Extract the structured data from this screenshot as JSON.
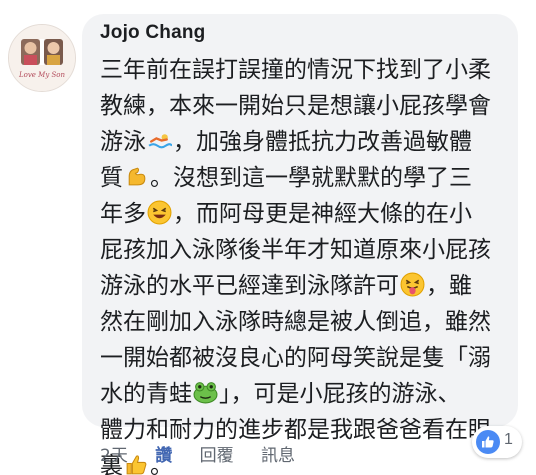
{
  "comment": {
    "author": "Jojo Chang",
    "avatar_caption": "Love My Son",
    "lines": [
      [
        "三年前在誤打誤撞的情況下找到了小柔"
      ],
      [
        "教練，本來一開始只是想讓小屁孩學會"
      ],
      [
        "游泳",
        "",
        "，加強身體抵抗力改善過敏體"
      ],
      [
        "質",
        "",
        "。沒想到這一學就默默的學了三"
      ],
      [
        "年多",
        "",
        "，而阿母更是神經大條的在小"
      ],
      [
        "屁孩加入泳隊後半年才知道原來小屁孩"
      ],
      [
        "游泳的水平已經達到泳隊許可",
        "",
        "，雖"
      ],
      [
        "然在剛加入泳隊時總是被人倒追，雖然"
      ],
      [
        "一開始都被沒良心的阿母笑說是隻「溺"
      ],
      [
        "水的青蛙",
        "",
        "」，可是小屁孩的游泳、"
      ],
      [
        "體力和耐力的進步都是我跟爸爸看在眼"
      ],
      [
        "裏",
        "",
        "。"
      ]
    ],
    "emoji_icons": [
      "swimmer-icon",
      "flexed-biceps-icon",
      "laughing-face-icon",
      "tongue-wink-face-icon",
      "frog-face-icon",
      "thumbs-up-icon"
    ]
  },
  "actions": {
    "time": "2天",
    "like": "讚",
    "reply": "回覆",
    "message": "訊息"
  },
  "reactions": {
    "icon": "like-reaction-icon",
    "count": "1"
  },
  "colors": {
    "bubble": "#f2f3f5",
    "text": "#1c1e21",
    "meta": "#606770",
    "like_blue": "#4267b2"
  }
}
